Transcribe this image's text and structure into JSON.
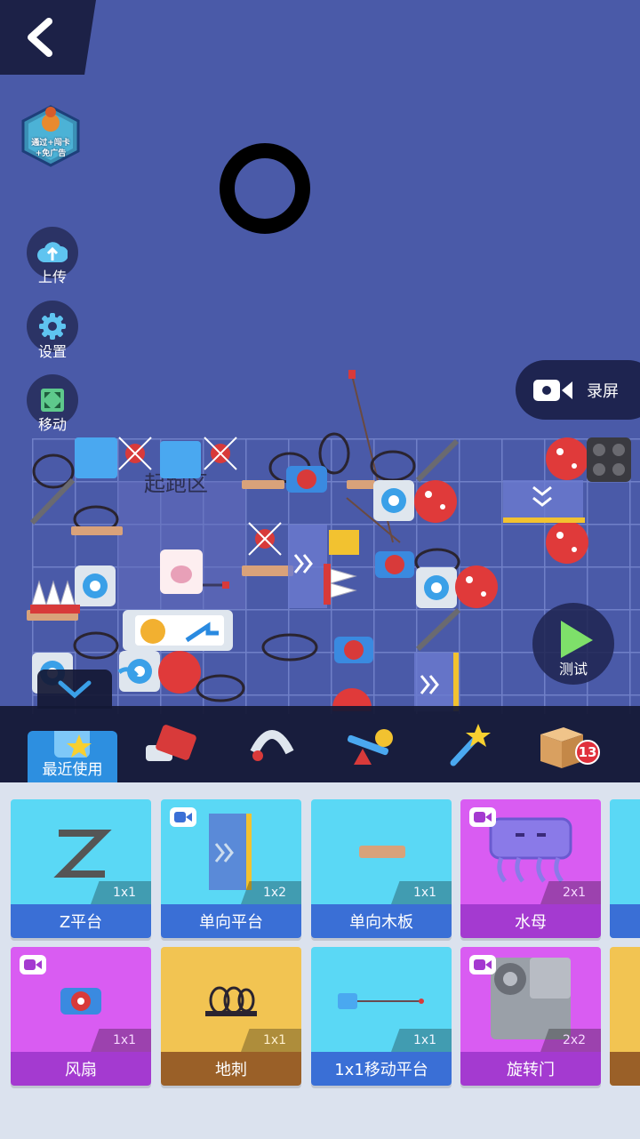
{
  "badge": {
    "line1": "通过+闯卡",
    "line2": "+免广告"
  },
  "side_buttons": {
    "upload": "上传",
    "settings": "设置",
    "move": "移动"
  },
  "record_label": "录屏",
  "test_label": "测试",
  "start_zone_label": "起跑区",
  "toolbar": {
    "recent_label": "最近使用",
    "box_count": "13",
    "tabs": [
      "recent",
      "blocks",
      "traps",
      "mechanisms",
      "magic",
      "box"
    ]
  },
  "palette": {
    "items": [
      {
        "name": "Z平台",
        "size": "1x1",
        "color": "cyan",
        "video": false
      },
      {
        "name": "单向平台",
        "size": "1x2",
        "color": "cyan",
        "video": true
      },
      {
        "name": "单向木板",
        "size": "1x1",
        "color": "cyan",
        "video": false
      },
      {
        "name": "水母",
        "size": "2x1",
        "color": "purple",
        "video": true
      },
      {
        "name": "风扇",
        "size": "1x1",
        "color": "purple",
        "video": true
      },
      {
        "name": "地刺",
        "size": "1x1",
        "color": "yellow",
        "video": false
      },
      {
        "name": "1x1移动平台",
        "size": "1x1",
        "color": "cyan",
        "video": false
      },
      {
        "name": "旋转门",
        "size": "2x2",
        "color": "purple",
        "video": true
      }
    ]
  },
  "colors": {
    "background": "#4a5aa8",
    "card_cyan": "#5ad8f5",
    "card_purple": "#d95cf2",
    "card_yellow": "#f2c452",
    "accent_blue": "#2d8fe0"
  }
}
